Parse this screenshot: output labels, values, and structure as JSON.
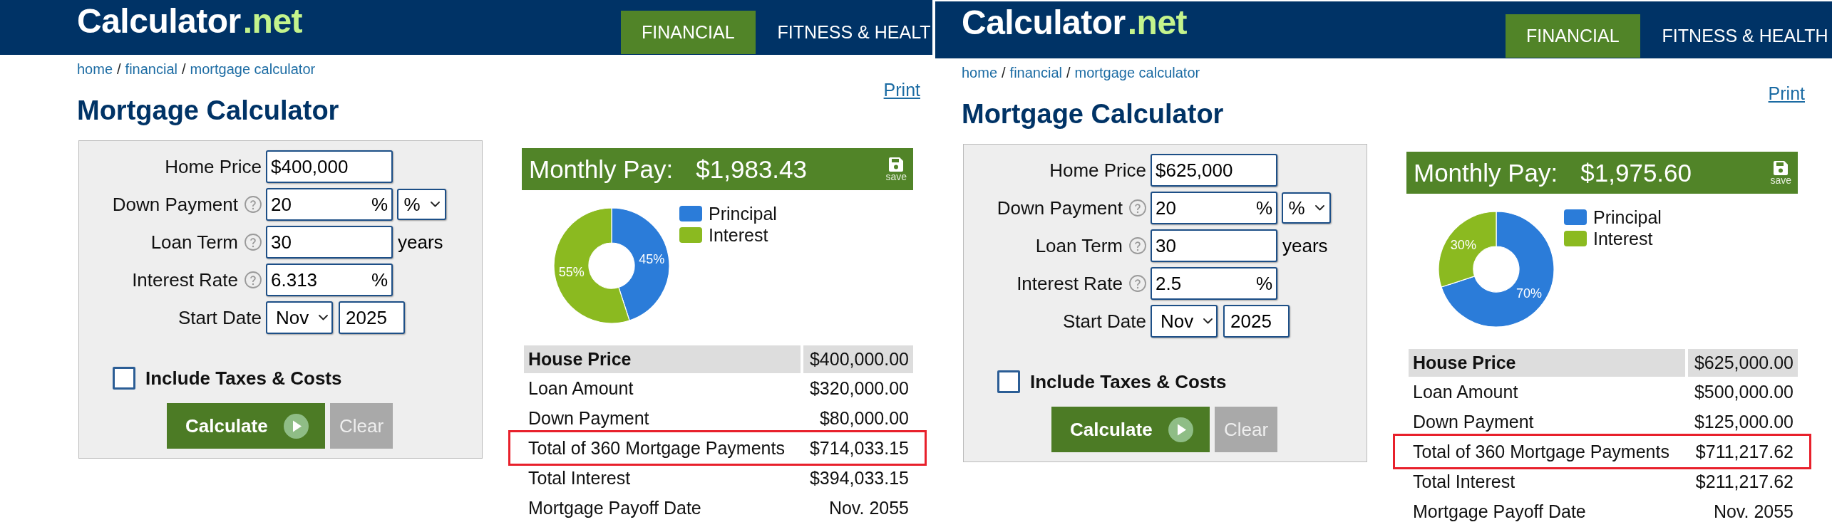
{
  "panels": [
    {
      "header": {
        "logo": {
          "text": "Calculator",
          "suffix": ".net"
        },
        "nav": [
          {
            "label": "FINANCIAL",
            "selected": true
          },
          {
            "label": "FITNESS & HEALT",
            "selected": false
          }
        ]
      },
      "breadcrumb": {
        "items": [
          "home",
          "financial",
          "mortgage calculator"
        ],
        "separator": "/"
      },
      "print_link": "Print",
      "title": "Mortgage Calculator",
      "form": {
        "fields": [
          {
            "kind": "input",
            "label": "Home Price",
            "help": false,
            "value": "$400,000"
          },
          {
            "kind": "input",
            "label": "Down Payment",
            "help": true,
            "value": "20",
            "suffix": "%",
            "select": "%"
          },
          {
            "kind": "input",
            "label": "Loan Term",
            "help": true,
            "value": "30",
            "unit": "years"
          },
          {
            "kind": "input",
            "label": "Interest Rate",
            "help": true,
            "value": "6.313",
            "suffix": "%"
          },
          {
            "kind": "date",
            "label": "Start Date",
            "help": false,
            "month": "Nov",
            "year": "2025"
          }
        ],
        "include_taxes": {
          "label": "Include Taxes & Costs",
          "checked": false
        },
        "buttons": [
          {
            "kind": "primary",
            "label": "Calculate"
          },
          {
            "kind": "secondary",
            "label": "Clear"
          }
        ]
      },
      "results": {
        "monthly_pay": {
          "label": "Monthly Pay:",
          "value": "$1,983.43",
          "save_label": "save"
        },
        "chart_data": {
          "type": "donut",
          "categories": [
            "Principal",
            "Interest"
          ],
          "values": [
            45,
            55
          ],
          "colors": [
            "#2b7cd9",
            "#8bba20"
          ],
          "value_labels": [
            "45%",
            "55%"
          ],
          "legend": "right"
        },
        "summary": {
          "rows": [
            {
              "label": "House Price",
              "value": "$400,000.00",
              "header": true,
              "highlighted": false
            },
            {
              "label": "Loan Amount",
              "value": "$320,000.00",
              "header": false,
              "highlighted": false
            },
            {
              "label": "Down Payment",
              "value": "$80,000.00",
              "header": false,
              "highlighted": false
            },
            {
              "label": "Total of 360 Mortgage Payments",
              "value": "$714,033.15",
              "header": false,
              "highlighted": true
            },
            {
              "label": "Total Interest",
              "value": "$394,033.15",
              "header": false,
              "highlighted": false
            },
            {
              "label": "Mortgage Payoff Date",
              "value": "Nov. 2055",
              "header": false,
              "highlighted": false
            }
          ]
        }
      }
    },
    {
      "header": {
        "logo": {
          "text": "Calculator",
          "suffix": ".net"
        },
        "nav": [
          {
            "label": "FINANCIAL",
            "selected": true
          },
          {
            "label": "FITNESS & HEALTH",
            "selected": false
          }
        ]
      },
      "breadcrumb": {
        "items": [
          "home",
          "financial",
          "mortgage calculator"
        ],
        "separator": "/"
      },
      "print_link": "Print",
      "title": "Mortgage Calculator",
      "form": {
        "fields": [
          {
            "kind": "input",
            "label": "Home Price",
            "help": false,
            "value": "$625,000"
          },
          {
            "kind": "input",
            "label": "Down Payment",
            "help": true,
            "value": "20",
            "suffix": "%",
            "select": "%"
          },
          {
            "kind": "input",
            "label": "Loan Term",
            "help": true,
            "value": "30",
            "unit": "years"
          },
          {
            "kind": "input",
            "label": "Interest Rate",
            "help": true,
            "value": "2.5",
            "suffix": "%"
          },
          {
            "kind": "date",
            "label": "Start Date",
            "help": false,
            "month": "Nov",
            "year": "2025"
          }
        ],
        "include_taxes": {
          "label": "Include Taxes & Costs",
          "checked": false
        },
        "buttons": [
          {
            "kind": "primary",
            "label": "Calculate"
          },
          {
            "kind": "secondary",
            "label": "Clear"
          }
        ]
      },
      "results": {
        "monthly_pay": {
          "label": "Monthly Pay:",
          "value": "$1,975.60",
          "save_label": "save"
        },
        "chart_data": {
          "type": "donut",
          "categories": [
            "Principal",
            "Interest"
          ],
          "values": [
            70,
            30
          ],
          "colors": [
            "#2b7cd9",
            "#8bba20"
          ],
          "value_labels": [
            "70%",
            "30%"
          ],
          "legend": "right"
        },
        "summary": {
          "rows": [
            {
              "label": "House Price",
              "value": "$625,000.00",
              "header": true,
              "highlighted": false
            },
            {
              "label": "Loan Amount",
              "value": "$500,000.00",
              "header": false,
              "highlighted": false
            },
            {
              "label": "Down Payment",
              "value": "$125,000.00",
              "header": false,
              "highlighted": false
            },
            {
              "label": "Total of 360 Mortgage Payments",
              "value": "$711,217.62",
              "header": false,
              "highlighted": true
            },
            {
              "label": "Total Interest",
              "value": "$211,217.62",
              "header": false,
              "highlighted": false
            },
            {
              "label": "Mortgage Payoff Date",
              "value": "Nov. 2055",
              "header": false,
              "highlighted": false
            }
          ]
        }
      }
    }
  ]
}
